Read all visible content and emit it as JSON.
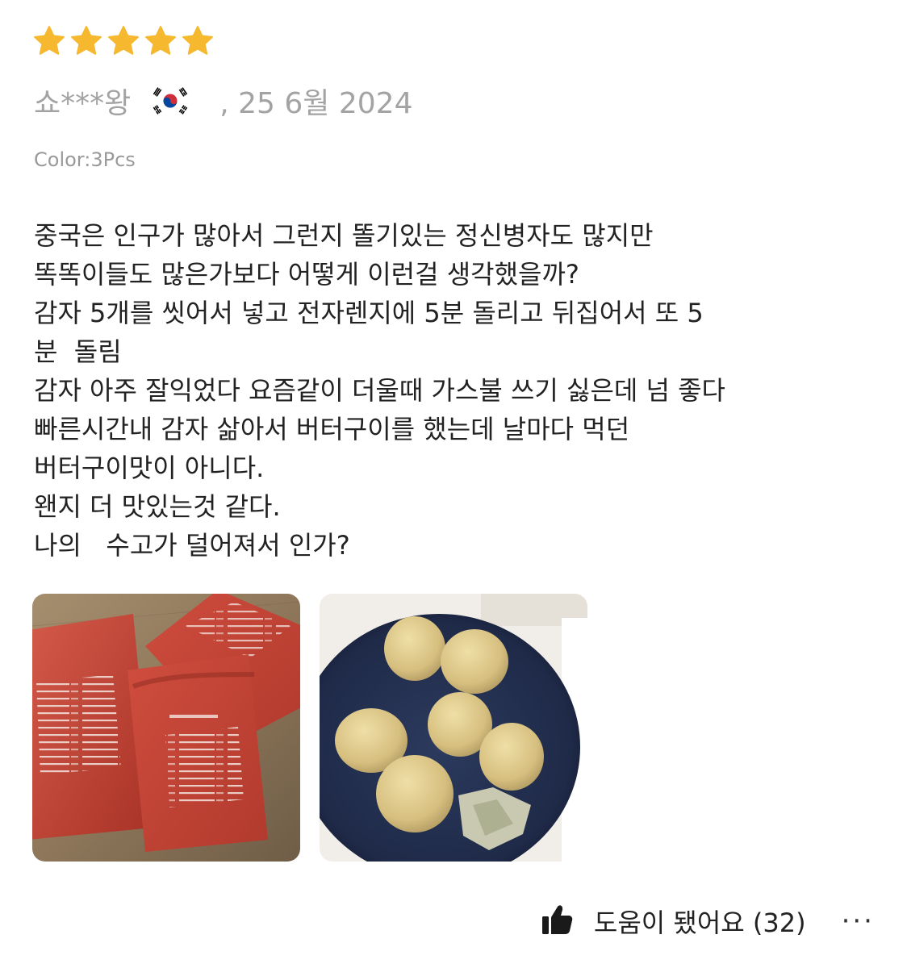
{
  "review": {
    "rating": 5,
    "rating_max": 5,
    "star_color": "#f5b82e",
    "reviewer": "쇼***왕",
    "country_flag_icon": "south-korea-flag-icon",
    "date": ", 25 6월 2024",
    "variant": "Color:3Pcs",
    "text_lines": [
      "중국은 인구가 많아서 그런지 똘기있는 정신병자도 많지만",
      "똑똑이들도 많은가보다 어떻게 이런걸 생각했을까?",
      "감자 5개를 씻어서 넣고 전자렌지에 5분 돌리고 뒤집어서 또 5",
      "분  돌림",
      "감자 아주 잘익었다 요즘같이 더울때 가스불 쓰기 싫은데 넘 좋다",
      "빠른시간내 감자 삶아서 버터구이를 했는데 날마다 먹던",
      "버터구이맛이 아니다.",
      "왠지 더 맛있는것 같다.",
      "나의   수고가 덜어져서 인가?"
    ]
  },
  "photos": {
    "photo_1_icon": "red-potato-bags-photo",
    "photo_2_icon": "baked-potatoes-plate-photo"
  },
  "footer": {
    "helpful_icon": "thumbs-up-icon",
    "helpful_label": "도움이 됐어요 (32)",
    "more_icon": "more-options-icon",
    "more_label": "···"
  }
}
